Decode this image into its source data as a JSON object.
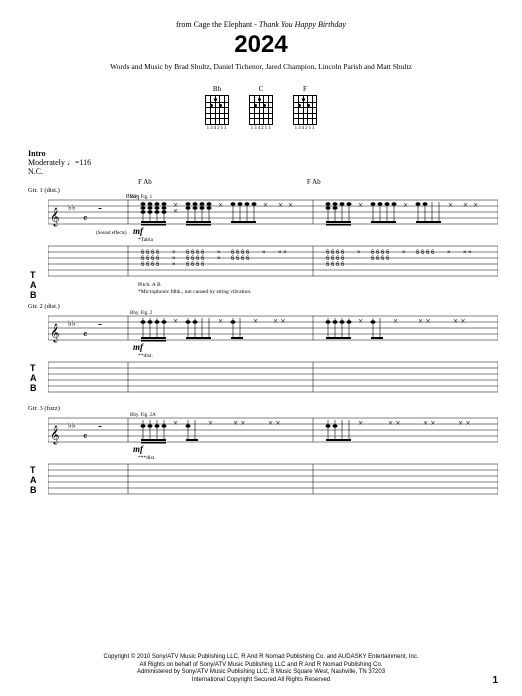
{
  "header": {
    "from_prefix": "from Cage the Elephant - ",
    "album": "Thank You Happy Birthday",
    "title": "2024",
    "credits": "Words and Music by Brad Shultz, Daniel Tichenor, Jared Champion, Lincoln Parish and Matt Shultz"
  },
  "chords": [
    {
      "name": "Bb",
      "fingering": "134211"
    },
    {
      "name": "C",
      "fingering": "134211"
    },
    {
      "name": "F",
      "fingering": "134211"
    }
  ],
  "intro": {
    "section": "Intro",
    "tempo_text": "Moderately ♩=116",
    "nc": "N.C."
  },
  "chord_marks": [
    "F  Ab",
    "F  Ab"
  ],
  "parts": [
    {
      "label": "Gtr. 1 (dist.)",
      "effect": "(Sound effects)",
      "dyn": "mf",
      "note": "*Tabla",
      "rhy": "Rhy. Fig. 1"
    },
    {
      "label": "Gtr. 2 (dist.)",
      "dyn": "mf",
      "note": "**dist.",
      "rhy": "Rhy. Fig. 2"
    },
    {
      "label": "Gtr. 3 (fuzz)",
      "dyn": "mf",
      "note": "***dist.",
      "rhy": "Rhy. Fig. 2A"
    }
  ],
  "footnotes": {
    "pitch": "Pitch: A  B",
    "microphonic": "*Microphonic fdbk., not caused by string vibration."
  },
  "tab_numbers": "6",
  "copyright": [
    "Copyright © 2010 Sony/ATV Music Publishing LLC, R And R Nomad Publishing Co. and AUDASKY Entertainment, Inc.",
    "All Rights on behalf of Sony/ATV Music Publishing LLC and R And R Nomad Publishing Co.",
    "Administered by Sony/ATV Music Publishing LLC, 8 Music Square West, Nashville, TN 37203",
    "International Copyright Secured   All Rights Reserved"
  ],
  "page_number": "1"
}
